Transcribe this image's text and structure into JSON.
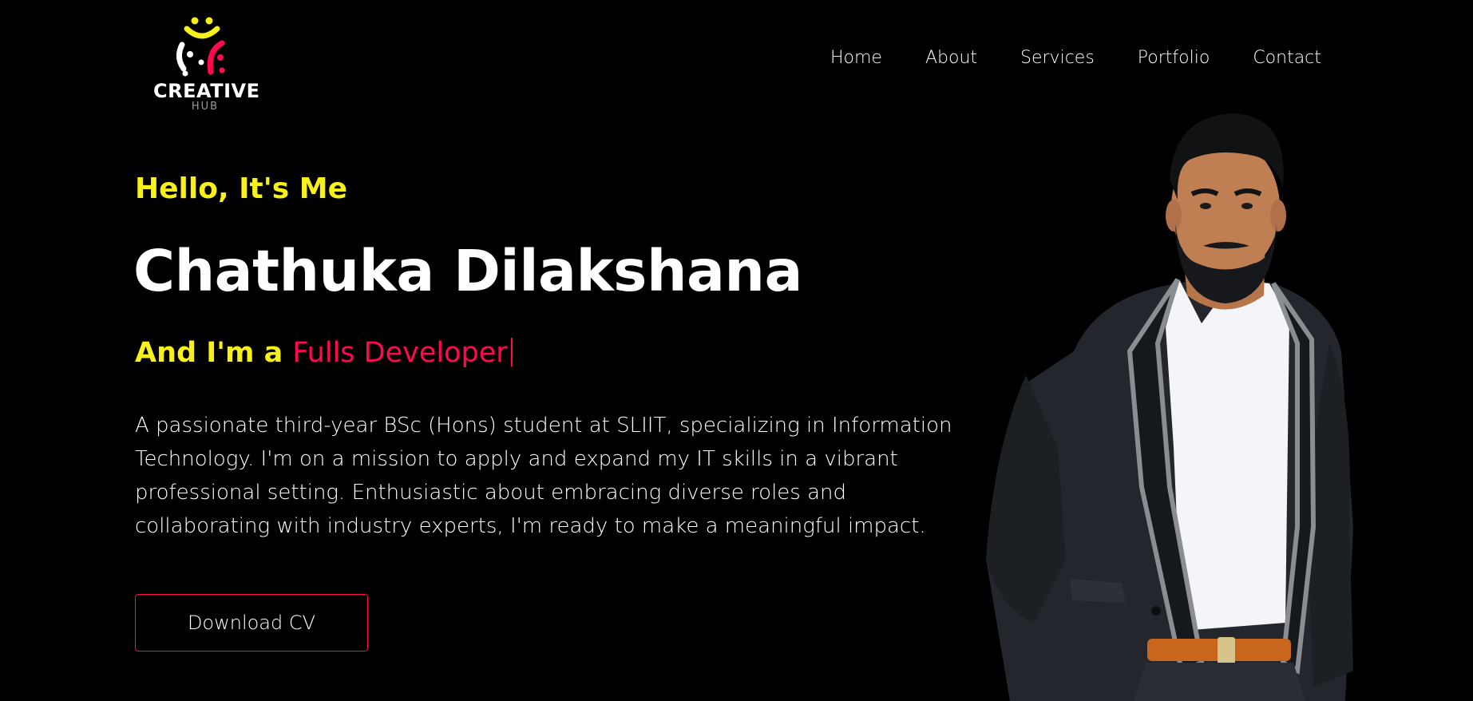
{
  "brand": {
    "name": "CREATIVE",
    "sub": "HUB",
    "logo_icon": "three-people-joined-icon",
    "colors": {
      "yellow": "#f7f01a",
      "pink": "#ff0a4d",
      "white": "#ffffff"
    }
  },
  "nav": {
    "items": [
      {
        "label": "Home"
      },
      {
        "label": "About"
      },
      {
        "label": "Services"
      },
      {
        "label": "Portfolio"
      },
      {
        "label": "Contact"
      }
    ]
  },
  "hero": {
    "greeting": "Hello, It's Me",
    "name": "Chathuka Dilakshana",
    "role_prefix": "And I'm a",
    "role_typed": "Fulls Developer",
    "description": "A passionate third-year BSc (Hons) student at SLIIT, specializing in Information Technology. I'm on a mission to apply and expand my IT skills in a vibrant professional setting. Enthusiastic about embracing diverse roles and collaborating with industry experts, I'm ready to make a meaningful impact.",
    "cta_label": "Download CV"
  },
  "theme": {
    "background": "#000000",
    "accent_yellow": "#f7f01a",
    "accent_pink": "#ff0a4d"
  }
}
